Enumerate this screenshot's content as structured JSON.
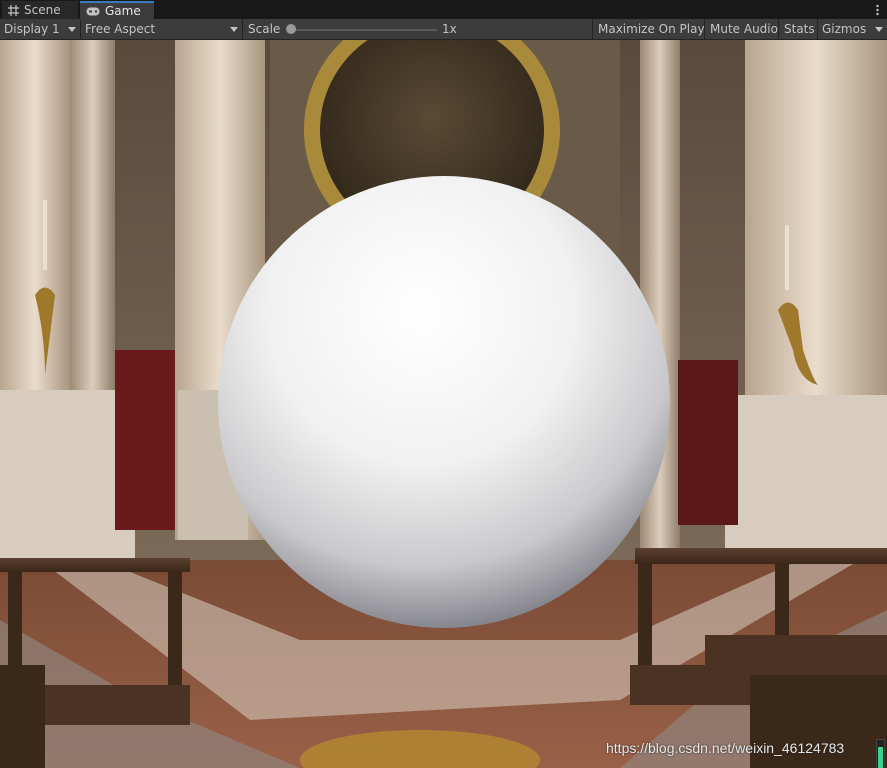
{
  "tabs": [
    {
      "label": "Scene",
      "icon": "hash-grid-icon",
      "active": false
    },
    {
      "label": "Game",
      "icon": "gamepad-icon",
      "active": true
    }
  ],
  "toolbar": {
    "display": "Display 1",
    "aspect": "Free Aspect",
    "scale_label": "Scale",
    "scale_value": "1x",
    "scale_slider_fraction": 0.0,
    "maximize_on_play": "Maximize On Play",
    "mute_audio": "Mute Audio",
    "stats": "Stats",
    "gizmos": "Gizmos"
  },
  "viewport": {
    "watermark": "https://blog.csdn.net/weixin_46124783",
    "fps_bar_fraction": 0.9
  },
  "colors": {
    "accent": "#3a79bb",
    "toolbar_bg": "#3c3c3c",
    "tabbar_bg": "#191919",
    "fps_indicator": "#3fd28a"
  }
}
